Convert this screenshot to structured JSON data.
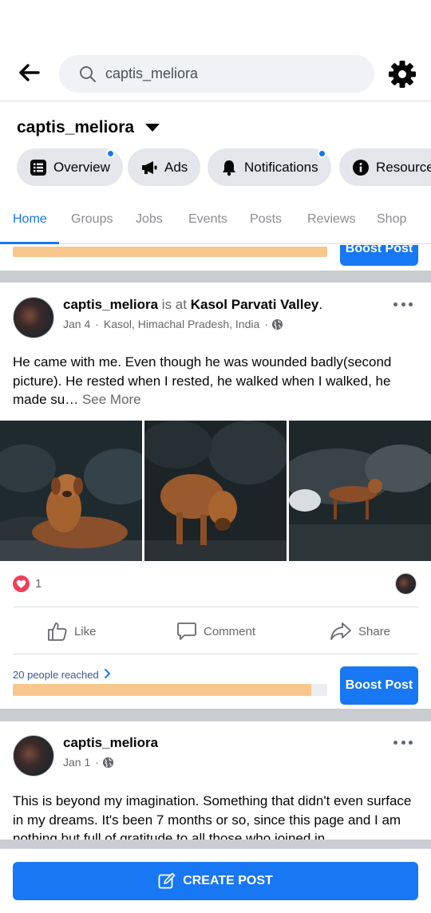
{
  "header": {
    "search_value": "captis_meliora"
  },
  "page": {
    "name": "captis_meliora"
  },
  "chips": [
    {
      "label": "Overview",
      "icon": "overview-icon",
      "dot": true
    },
    {
      "label": "Ads",
      "icon": "megaphone-icon",
      "dot": false
    },
    {
      "label": "Notifications",
      "icon": "bell-icon",
      "dot": true
    },
    {
      "label": "Resources",
      "icon": "info-icon",
      "dot": false
    }
  ],
  "tabs": [
    "Home",
    "Groups",
    "Jobs",
    "Events",
    "Posts",
    "Reviews",
    "Shop"
  ],
  "active_tab": "Home",
  "partial_boost": {
    "button_label": "Boost Post",
    "progress": 1.0
  },
  "post1": {
    "author": "captis_meliora",
    "is_at": "is at",
    "place": "Kasol Parvati Valley",
    "place_suffix": ".",
    "date": "Jan 4",
    "dot": "·",
    "location": "Kasol, Himachal Pradesh, India",
    "text": "He came with me. Even though he was wounded badly(second picture). He rested when I rested, he walked when I walked, he made su…",
    "see_more": "See More",
    "reaction_count": "1",
    "like_label": "Like",
    "comment_label": "Comment",
    "share_label": "Share",
    "reach_label": "20 people reached",
    "reach_progress": 0.95,
    "boost_label": "Boost Post"
  },
  "post2": {
    "author": "captis_meliora",
    "date": "Jan 1",
    "dot": "·",
    "text": "This is beyond my imagination. Something that didn't even surface in my dreams. It's been 7 months or so, since this page and I am nothing but full of gratitude to all those who joined in"
  },
  "footer": {
    "create_label": "CREATE POST"
  },
  "colors": {
    "accent": "#1877f2",
    "progress": "#f7c78d",
    "heart": "#f33e58"
  }
}
